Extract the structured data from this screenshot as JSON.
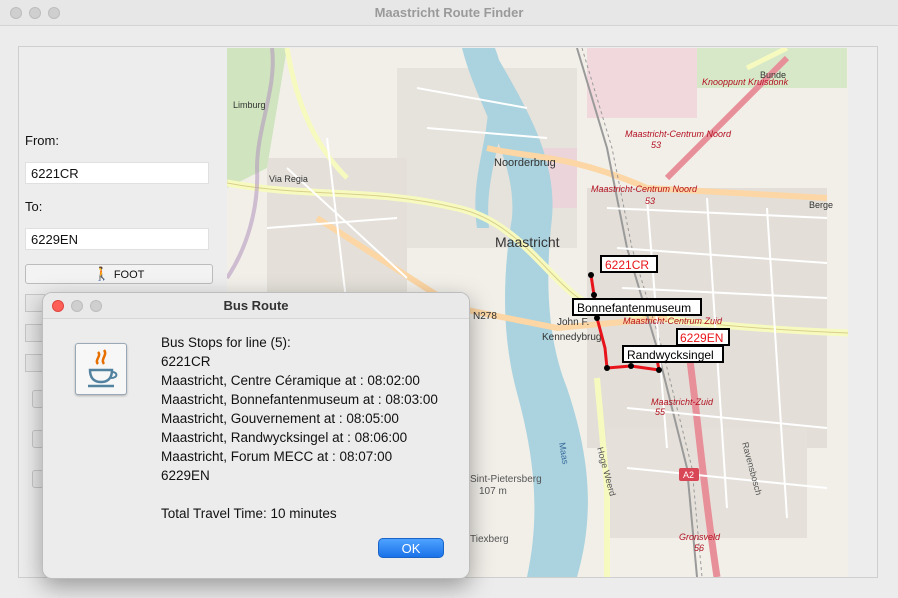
{
  "window": {
    "title": "Maastricht Route Finder"
  },
  "form": {
    "from_label": "From:",
    "from_value": "6221CR",
    "to_label": "To:",
    "to_value": "6229EN",
    "foot_button_label": "FOOT",
    "foot_icon": "walking-person-icon"
  },
  "map": {
    "place_labels": {
      "city": "Maastricht",
      "noorderbrug": "Noorderbrug",
      "via_regia": "Via Regia",
      "n278": "N278",
      "john_f": "John F.",
      "kennedybrug": "Kennedybrug",
      "limburg": "Limburg",
      "knooppunt": "Knooppunt Kruisdonk",
      "centrum_noord_1": "Maastricht-Centrum Noord",
      "centrum_noord_1_no": "53",
      "centrum_noord_2": "Maastricht-Centrum Noord",
      "centrum_noord_2_no": "53",
      "centrum_zuid": "Maastricht-Centrum Zuid",
      "zuid": "Maastricht-Zuid",
      "zuid_no": "55",
      "gronsveld": "Gronsveld",
      "gronsveld_no": "56",
      "sint_pietersberg": "Sint-Pietersberg",
      "sint_pietersberg_alt": "107 m",
      "maas": "Maas",
      "hoge_weerd": "Hoge Weerd",
      "a2": "A2",
      "berge": "Berge",
      "bunde": "Bunde",
      "tiexberg": "Tiexberg",
      "ravensbosch": "Ravensbosch"
    },
    "route_labels": {
      "origin": "6221CR",
      "stop_bonnefanten": "Bonnefantenmuseum",
      "destination": "6229EN",
      "stop_randwyck": "Randwycksingel"
    },
    "colors": {
      "route": "#e8141c",
      "water": "#aad3df",
      "forest": "#c8e0b4",
      "motorway": "#e8909a"
    }
  },
  "dialog": {
    "title": "Bus Route",
    "icon": "java-coffee-cup-icon",
    "lines": [
      "Bus Stops for line (5):",
      "6221CR",
      "Maastricht, Centre Céramique at : 08:02:00",
      "Maastricht, Bonnefantenmuseum at : 08:03:00",
      "Maastricht, Gouvernement at : 08:05:00",
      "Maastricht, Randwycksingel at : 08:06:00",
      "Maastricht, Forum MECC at : 08:07:00",
      "6229EN"
    ],
    "total": "Total Travel Time: 10 minutes",
    "ok_label": "OK"
  }
}
